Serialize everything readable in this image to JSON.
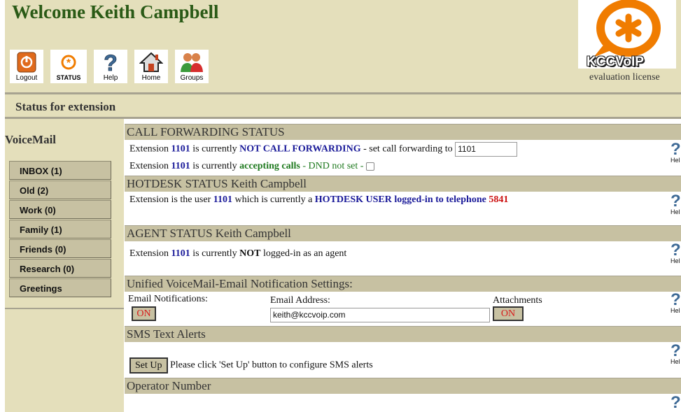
{
  "header": {
    "welcome": "Welcome Keith Campbell",
    "toolbar": [
      {
        "label": "Logout",
        "icon": "logout-icon"
      },
      {
        "label": "STATUS",
        "icon": "status-icon"
      },
      {
        "label": "Help",
        "icon": "help-icon"
      },
      {
        "label": "Home",
        "icon": "home-icon"
      },
      {
        "label": "Groups",
        "icon": "groups-icon"
      }
    ],
    "logo_text": "KCCVoIP",
    "license": "evaluation license"
  },
  "status_title": "Status for extension",
  "sidebar": {
    "title": "VoiceMail",
    "items": [
      {
        "label": "INBOX (1)"
      },
      {
        "label": "Old (2)"
      },
      {
        "label": "Work (0)"
      },
      {
        "label": "Family (1)"
      },
      {
        "label": "Friends (0)"
      },
      {
        "label": "Research (0)"
      },
      {
        "label": "Greetings"
      }
    ]
  },
  "sections": {
    "call_forwarding": {
      "title": "CALL FORWARDING STATUS",
      "l1_prefix": "Extension ",
      "ext": "1101",
      "l1_mid": " is currently ",
      "l1_state": "NOT CALL FORWARDING",
      "l1_suffix": " - set call forwarding to ",
      "forward_value": "1101",
      "l2_prefix": "Extension ",
      "l2_mid": " is currently ",
      "l2_state": "accepting calls",
      "l2_suffix": " - DND not set - "
    },
    "hotdesk": {
      "title": "HOTDESK STATUS Keith Campbell",
      "prefix": "Extension is the user ",
      "user": "1101",
      "mid": " which is currently a ",
      "state": "HOTDESK USER logged-in to telephone",
      "phone": "5841"
    },
    "agent": {
      "title": "AGENT STATUS Keith Campbell",
      "prefix": "Extension ",
      "ext": "1101",
      "mid": " is currently ",
      "state": "NOT",
      "suffix": " logged-in as an agent"
    },
    "email": {
      "title": "Unified VoiceMail-Email Notification Settings:",
      "notif_label": "Email Notifications:",
      "notif_value": "ON",
      "address_label": "Email Address:",
      "address_value": "keith@kccvoip.com",
      "attach_label": "Attachments",
      "attach_value": "ON"
    },
    "sms": {
      "title": "SMS Text Alerts",
      "button": "Set Up",
      "text": "Please click 'Set Up' button to configure SMS alerts"
    },
    "operator": {
      "title": "Operator Number"
    }
  },
  "help_label": "Hel",
  "colors": {
    "header_bg": "#e4dfbb",
    "section_bg": "#c7c1a2",
    "welcome": "#2a5a16",
    "link_blue": "#1a1a99",
    "accent_green": "#1f7a1f",
    "alert_red": "#cc1111",
    "logo_orange": "#f07c00"
  }
}
